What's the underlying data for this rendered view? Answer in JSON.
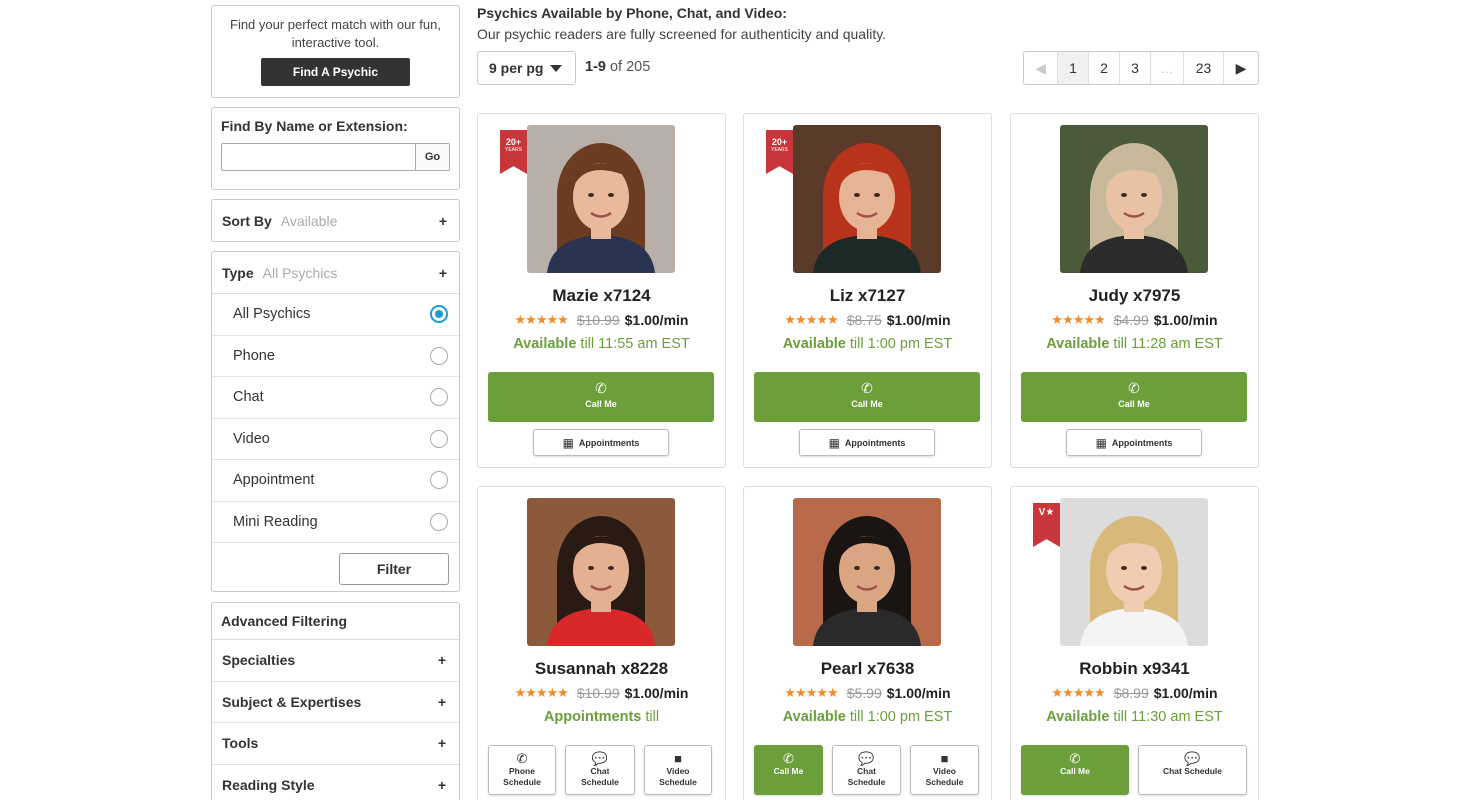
{
  "sidebar": {
    "promo": {
      "text": "Find your perfect match with our fun, interactive tool.",
      "button": "Find A Psychic"
    },
    "name_search": {
      "title": "Find By Name or Extension:",
      "value": "",
      "go": "Go"
    },
    "sort": {
      "label": "Sort By",
      "value": "Available",
      "toggle": "+"
    },
    "type": {
      "label": "Type",
      "value": "All Psychics",
      "toggle": "+",
      "options": [
        {
          "label": "All Psychics",
          "selected": true
        },
        {
          "label": "Phone",
          "selected": false
        },
        {
          "label": "Chat",
          "selected": false
        },
        {
          "label": "Video",
          "selected": false
        },
        {
          "label": "Appointment",
          "selected": false
        },
        {
          "label": "Mini Reading",
          "selected": false
        }
      ],
      "filter_button": "Filter"
    },
    "advanced": {
      "title": "Advanced Filtering",
      "items": [
        {
          "label": "Specialties",
          "toggle": "+"
        },
        {
          "label": "Subject & Expertises",
          "toggle": "+"
        },
        {
          "label": "Tools",
          "toggle": "+"
        },
        {
          "label": "Reading Style",
          "toggle": "+"
        }
      ]
    }
  },
  "main": {
    "title": "Psychics Available by Phone, Chat, and Video:",
    "subtitle": "Our psychic readers are fully screened for authenticity and quality.",
    "per_page": "9 per pg",
    "range_bold": "1-9",
    "range_rest": " of 205",
    "pager": {
      "prev": "◀",
      "pages": [
        "1",
        "2",
        "3",
        "...",
        "23"
      ],
      "current": "1",
      "next": "▶"
    }
  },
  "colors": {
    "accent_green": "#6a9f3a",
    "ribbon_red": "#c8353a",
    "radio_blue": "#1b9ad6",
    "star_orange": "#f08c2c"
  },
  "psychics": [
    {
      "name": "Mazie x7124",
      "rating": 5,
      "old_price": "$10.99",
      "price": "$1.00/min",
      "status": "Available",
      "status_rest": " till 11:55 am EST",
      "ribbon": "20+",
      "ribbon_sub": "YEARS",
      "call": "Call Me",
      "appt": "Appointments",
      "photo": {
        "bg": "#b8b0a8",
        "hair": "#6b3b22",
        "skin": "#e8b99a",
        "shirt": "#2a3352"
      }
    },
    {
      "name": "Liz x7127",
      "rating": 5,
      "old_price": "$8.75",
      "price": "$1.00/min",
      "status": "Available",
      "status_rest": " till 1:00 pm EST",
      "ribbon": "20+",
      "ribbon_sub": "YEARS",
      "call": "Call Me",
      "appt": "Appointments",
      "photo": {
        "bg": "#5b3a2a",
        "hair": "#b8331c",
        "skin": "#e6b494",
        "shirt": "#1e2a28"
      }
    },
    {
      "name": "Judy x7975",
      "rating": 5,
      "old_price": "$4.99",
      "price": "$1.00/min",
      "status": "Available",
      "status_rest": " till 11:28 am EST",
      "call": "Call Me",
      "appt": "Appointments",
      "photo": {
        "bg": "#4a5a3a",
        "hair": "#c8b99a",
        "skin": "#e9c2a5",
        "shirt": "#2b2b2b"
      }
    },
    {
      "name": "Susannah x8228",
      "rating": 5,
      "old_price": "$10.99",
      "price": "$1.00/min",
      "status": "Appointments",
      "status_rest": " till",
      "buttons": [
        {
          "icon": "phone-icon",
          "glyph": "✆",
          "label": "Phone\nSchedule",
          "green": false,
          "w": 68
        },
        {
          "icon": "chat-icon",
          "glyph": "💬",
          "label": "Chat\nSchedule",
          "green": false,
          "w": 70
        },
        {
          "icon": "video-icon",
          "glyph": "■",
          "label": "Video\nSchedule",
          "green": false,
          "w": 68
        }
      ],
      "photo": {
        "bg": "#8a5a3a",
        "hair": "#2a1a14",
        "skin": "#e4b092",
        "shirt": "#d8282a"
      }
    },
    {
      "name": "Pearl x7638",
      "rating": 5,
      "old_price": "$5.99",
      "price": "$1.00/min",
      "status": "Available",
      "status_rest": " till 1:00 pm EST",
      "buttons": [
        {
          "icon": "phone-icon",
          "glyph": "✆",
          "label": "Call Me",
          "green": true,
          "w": 69
        },
        {
          "icon": "chat-icon",
          "glyph": "💬",
          "label": "Chat\nSchedule",
          "green": false,
          "w": 69
        },
        {
          "icon": "video-icon",
          "glyph": "■",
          "label": "Video\nSchedule",
          "green": false,
          "w": 69
        }
      ],
      "photo": {
        "bg": "#b86a4a",
        "hair": "#1a1412",
        "skin": "#d9a582",
        "shirt": "#2a2a2a"
      }
    },
    {
      "name": "Robbin x9341",
      "rating": 5,
      "old_price": "$8.99",
      "price": "$1.00/min",
      "status": "Available",
      "status_rest": " till 11:30 am EST",
      "ribbon": "V★",
      "ribbon_sub": "",
      "buttons": [
        {
          "icon": "phone-icon",
          "glyph": "✆",
          "label": "Call Me",
          "green": true,
          "w": 108
        },
        {
          "icon": "chat-icon",
          "glyph": "💬",
          "label": "Chat Schedule",
          "green": false,
          "w": 109
        }
      ],
      "photo": {
        "bg": "#dcdcdc",
        "hair": "#d9b97a",
        "skin": "#efcdb2",
        "shirt": "#f4f4f4"
      }
    }
  ]
}
